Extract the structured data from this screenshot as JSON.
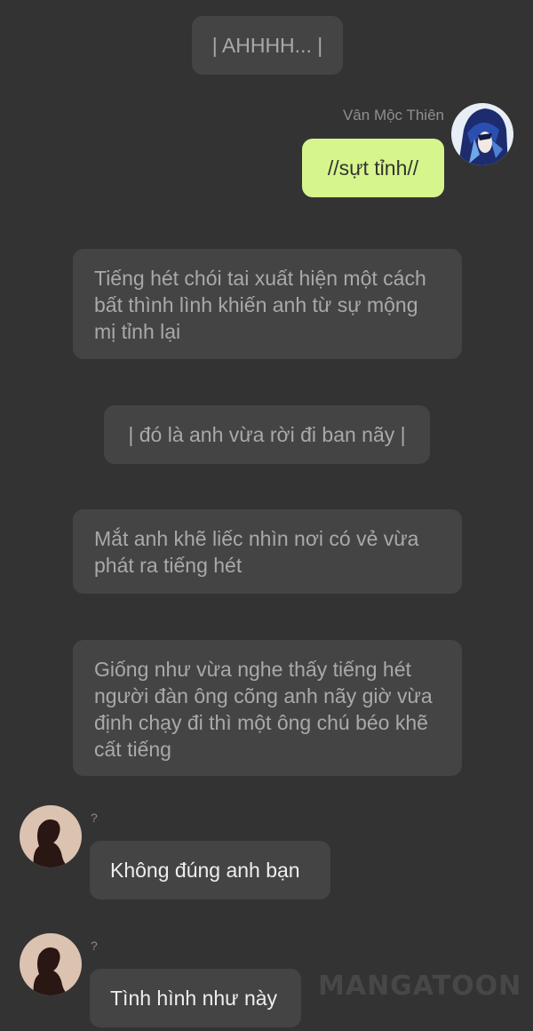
{
  "messages": {
    "narration_1": "| AHHHH... |",
    "sender_name": "Vân Mộc Thiên",
    "outgoing_1": "//sựt tỉnh//",
    "narration_2": "Tiếng hét chói tai xuất hiện một cách bất thình lình khiến anh từ sự mộng mị tỉnh lại",
    "narration_3": "| đó là anh vừa rời đi ban nãy |",
    "narration_4": "Mắt anh khẽ liếc nhìn nơi có vẻ vừa phát ra tiếng hét",
    "narration_5": "Giống như vừa nghe thấy tiếng hét người đàn ông cõng anh nãy giờ vừa định chạy đi thì một ông chú béo khẽ cất tiếng",
    "unknown_sender_label": "?",
    "incoming_1": "Không đúng anh bạn",
    "incoming_2": "Tình hình như này"
  },
  "watermark": "MANGATOON",
  "colors": {
    "background": "#333333",
    "narration_bg": "#444444",
    "outgoing_bg": "#d6f58c"
  },
  "icons": {
    "user_avatar": "anime-avatar-blue-hair",
    "unknown_avatar": "silhouette-avatar"
  }
}
